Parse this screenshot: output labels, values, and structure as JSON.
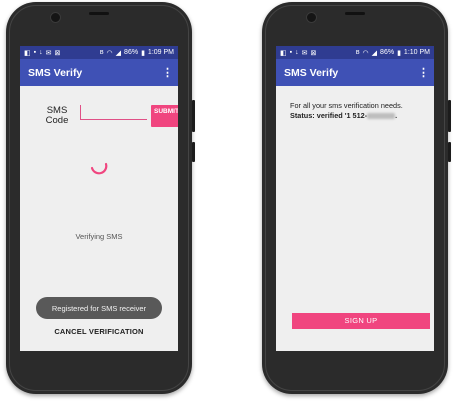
{
  "phones": [
    {
      "status_bar": {
        "battery": "86%",
        "time": "1:09 PM"
      },
      "app_title": "SMS Verify",
      "overflow_icon": "more-vert-icon",
      "sms_code_label": "SMS Code",
      "submit_label": "SUBMIT",
      "progress_text": "Verifying SMS",
      "toast_text": "Registered for SMS receiver",
      "cancel_label": "CANCEL VERIFICATION"
    },
    {
      "status_bar": {
        "battery": "86%",
        "time": "1:10 PM"
      },
      "app_title": "SMS Verify",
      "overflow_icon": "more-vert-icon",
      "info_line": "For all your sms verification needs.",
      "status_label": "Status: verified '1 512-",
      "status_suffix": ".",
      "signup_label": "SIGN UP"
    }
  ],
  "colors": {
    "status_bar": "#2f3c91",
    "app_bar": "#3f51b5",
    "accent": "#f0457f",
    "phone_body": "#2b2b2b"
  }
}
